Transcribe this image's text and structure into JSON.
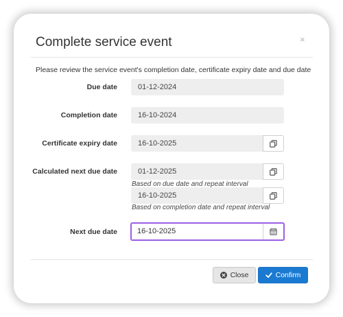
{
  "dialog": {
    "title": "Complete service event",
    "close_symbol": "×",
    "intro": "Please review the service event's completion date, certificate expiry date and due date"
  },
  "fields": {
    "due_date": {
      "label": "Due date",
      "value": "01-12-2024"
    },
    "completion_date": {
      "label": "Completion date",
      "value": "16-10-2024"
    },
    "certificate_expiry": {
      "label": "Certificate expiry date",
      "value": "16-10-2025"
    },
    "calculated_next_due": {
      "label": "Calculated next due date",
      "option_1": {
        "value": "01-12-2025",
        "hint": "Based on due date and repeat interval"
      },
      "option_2": {
        "value": "16-10-2025",
        "hint": "Based on completion date and repeat interval"
      }
    },
    "next_due_date": {
      "label": "Next due date",
      "value": "16-10-2025"
    }
  },
  "buttons": {
    "close_label": "Close",
    "confirm_label": "Confirm"
  },
  "icons": {
    "copy": "copy-icon",
    "calendar": "calendar-icon",
    "close_circle": "times-circle-icon",
    "check": "check-icon"
  },
  "colors": {
    "focus_border": "#9b5de5",
    "confirm_bg": "#1a7ad1",
    "field_bg": "#eeeeee"
  }
}
